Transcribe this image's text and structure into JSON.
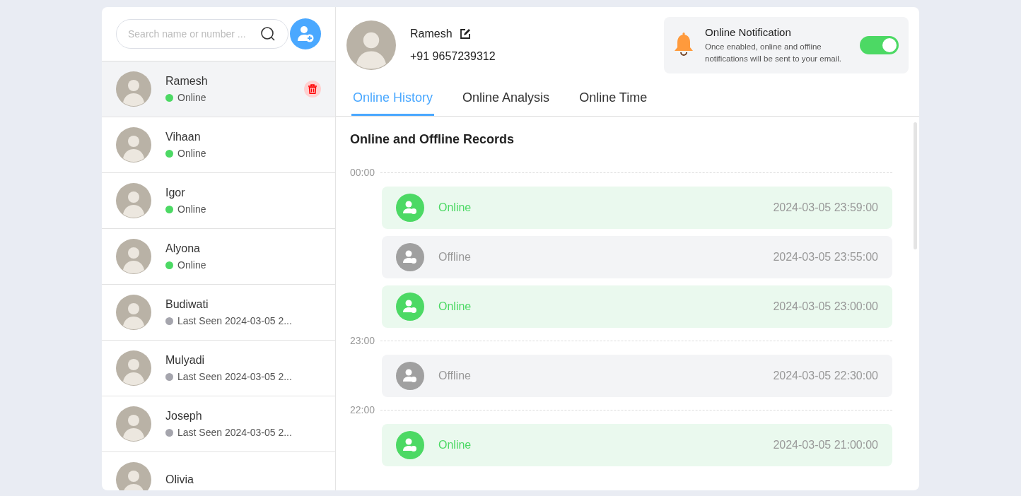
{
  "search": {
    "placeholder": "Search name or number ..."
  },
  "contacts": [
    {
      "name": "Ramesh",
      "status": "Online",
      "online": true,
      "selected": true
    },
    {
      "name": "Vihaan",
      "status": "Online",
      "online": true,
      "selected": false
    },
    {
      "name": "Igor",
      "status": "Online",
      "online": true,
      "selected": false
    },
    {
      "name": "Alyona",
      "status": "Online",
      "online": true,
      "selected": false
    },
    {
      "name": "Budiwati",
      "status": "Last Seen 2024-03-05 2...",
      "online": false,
      "selected": false
    },
    {
      "name": "Mulyadi",
      "status": "Last Seen 2024-03-05 2...",
      "online": false,
      "selected": false
    },
    {
      "name": "Joseph",
      "status": "Last Seen 2024-03-05 2...",
      "online": false,
      "selected": false
    },
    {
      "name": "Olivia",
      "selected": false
    }
  ],
  "profile": {
    "name": "Ramesh",
    "phone": "+91 9657239312"
  },
  "notification": {
    "title": "Online Notification",
    "description": "Once enabled, online and offline notifications will be sent to your email.",
    "on": true
  },
  "tabs": [
    {
      "label": "Online History",
      "selected": true
    },
    {
      "label": "Online Analysis",
      "selected": false
    },
    {
      "label": "Online Time",
      "selected": false
    }
  ],
  "records_title": "Online and Offline Records",
  "timeline": [
    {
      "kind": "time",
      "label": "00:00"
    },
    {
      "kind": "record",
      "online": true,
      "status": "Online",
      "time": "2024-03-05 23:59:00"
    },
    {
      "kind": "record",
      "online": false,
      "status": "Offline",
      "time": "2024-03-05 23:55:00"
    },
    {
      "kind": "record",
      "online": true,
      "status": "Online",
      "time": "2024-03-05 23:00:00"
    },
    {
      "kind": "time",
      "label": "23:00"
    },
    {
      "kind": "record",
      "online": false,
      "status": "Offline",
      "time": "2024-03-05 22:30:00"
    },
    {
      "kind": "time",
      "label": "22:00"
    },
    {
      "kind": "record",
      "online": true,
      "status": "Online",
      "time": "2024-03-05 21:00:00"
    }
  ]
}
